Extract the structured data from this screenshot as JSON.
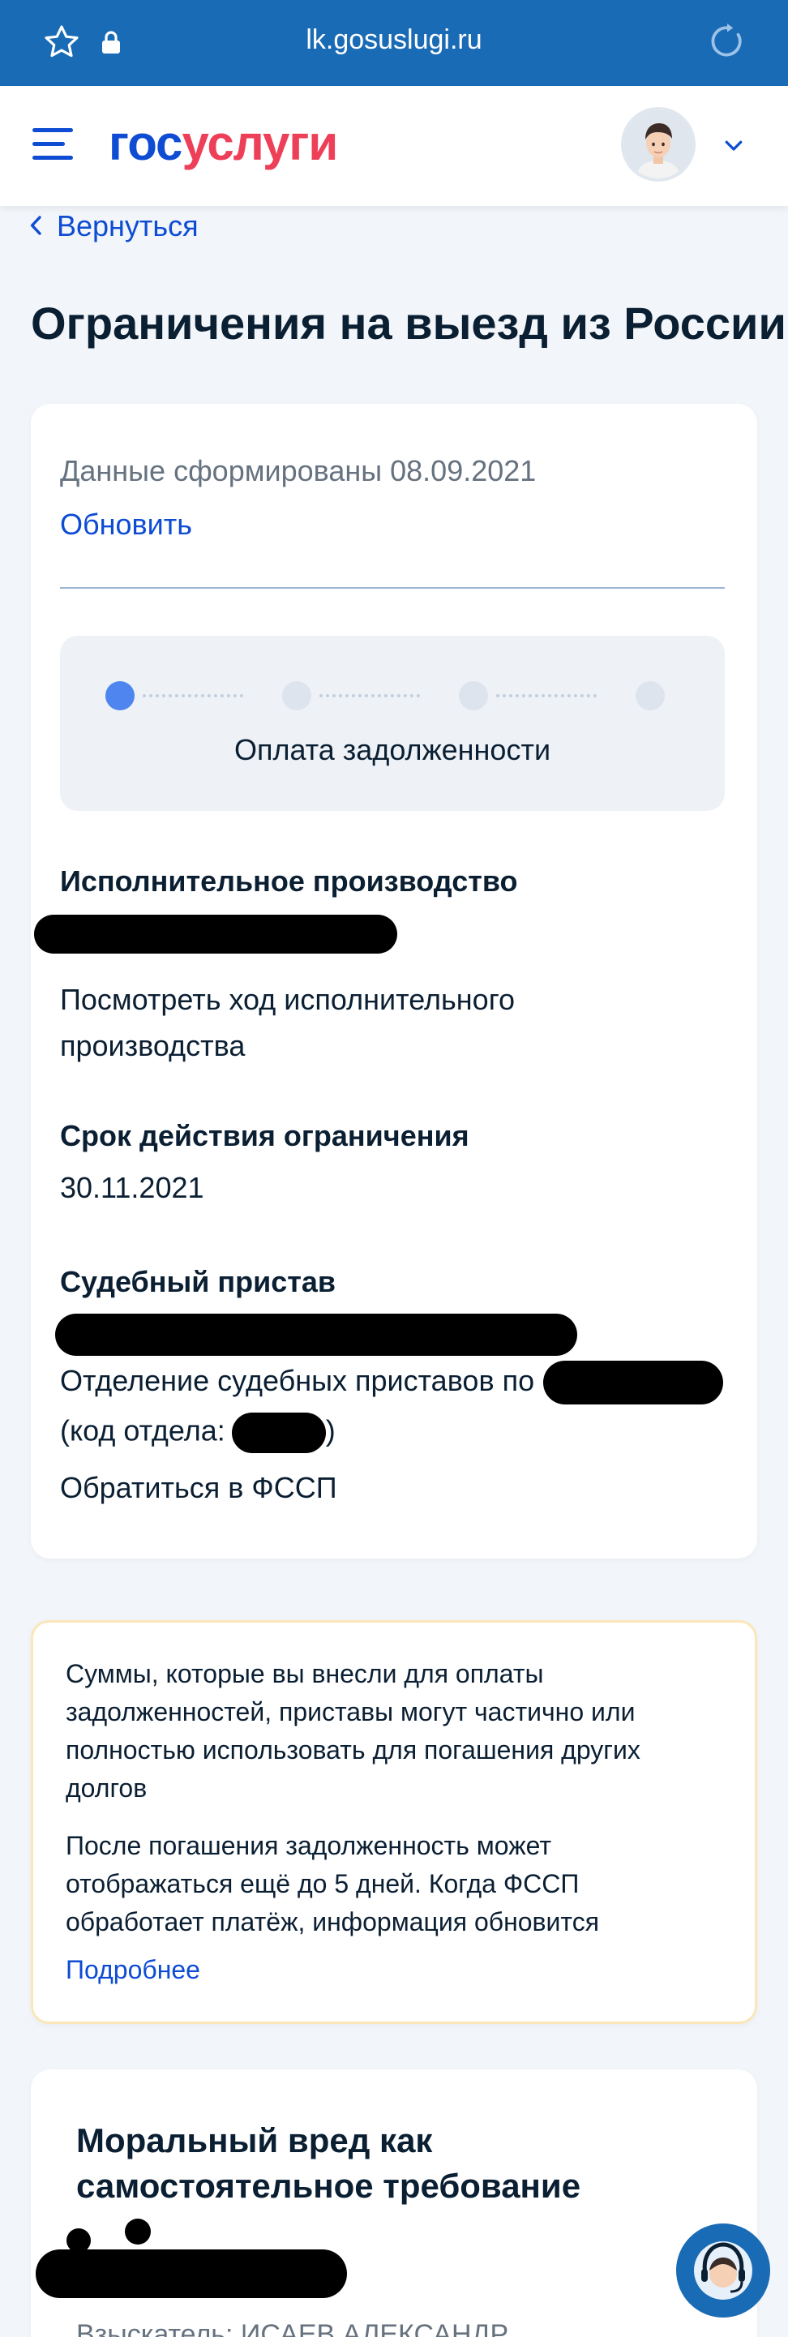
{
  "browser": {
    "url": "lk.gosuslugi.ru",
    "star_icon": "star-outline-icon",
    "lock_icon": "lock-icon",
    "reload_icon": "reload-icon"
  },
  "header": {
    "logo_part1": "гос",
    "logo_part2": "услуги",
    "menu_icon": "hamburger-menu-icon",
    "avatar": "user-avatar",
    "chevron_icon": "chevron-down-icon"
  },
  "back_label": "Вернуться",
  "page_title": "Ограничения на выезд из России",
  "card": {
    "generated": "Данные сформированы 08.09.2021",
    "refresh": "Обновить",
    "stepper": {
      "steps_total": 4,
      "current_step": 1,
      "label": "Оплата задолженности"
    },
    "proceeding_heading": "Исполнительное производство",
    "proceeding_link": "Посмотреть ход исполнительного производства",
    "term_heading": "Срок действия ограничения",
    "term_value": "30.11.2021",
    "bailiff_heading": "Судебный пристав",
    "bailiff_dept": "Отделение судебных приставов по",
    "bailiff_code_prefix": "(код отдела:",
    "bailiff_code_suffix": ")",
    "fssp_link": "Обратиться в ФССП"
  },
  "notice": {
    "p1": "Суммы, которые вы внесли для оплаты задолженностей, приставы могут частично или полностью использовать для погашения других долгов",
    "p2": "После погашения задолженность может отображаться ещё до 5 дней. Когда ФССП обработает платёж, информация обновится",
    "more": "Подробнее"
  },
  "second_card": {
    "title": "Моральный вред как самостоятельное требование",
    "cut_text": "Взыскатель: ИСАЕВ АЛЕКСАНДР"
  },
  "support_icon": "support-operator-icon",
  "colors": {
    "brand_blue": "#0d4cd3",
    "brand_red": "#ee3f58",
    "browser_bar": "#1a6bb5",
    "page_bg": "#f2f5f9",
    "notice_border": "#fae7b8"
  }
}
